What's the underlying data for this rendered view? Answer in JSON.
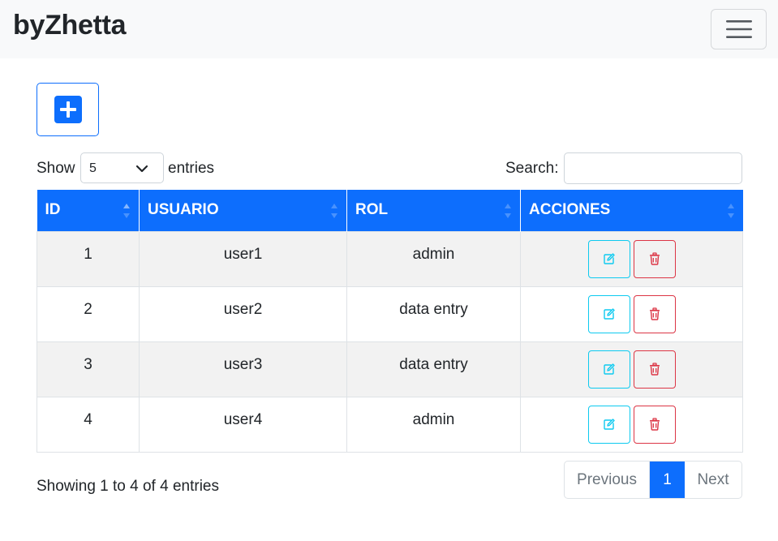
{
  "navbar": {
    "brand": "byZhetta",
    "toggler_icon": "menu-icon"
  },
  "toolbar": {
    "add_icon": "plus-square-icon"
  },
  "length_control": {
    "show_label": "Show",
    "selected_value": "5",
    "entries_label": "entries"
  },
  "search": {
    "label": "Search:",
    "value": "",
    "placeholder": ""
  },
  "table": {
    "columns": [
      "ID",
      "USUARIO",
      "ROL",
      "ACCIONES"
    ],
    "rows": [
      {
        "id": "1",
        "usuario": "user1",
        "rol": "admin"
      },
      {
        "id": "2",
        "usuario": "user2",
        "rol": "data entry"
      },
      {
        "id": "3",
        "usuario": "user3",
        "rol": "data entry"
      },
      {
        "id": "4",
        "usuario": "user4",
        "rol": "admin"
      }
    ],
    "edit_icon": "edit-icon",
    "delete_icon": "trash-icon"
  },
  "footer": {
    "info": "Showing 1 to 4 of 4 entries",
    "pagination": {
      "previous": "Previous",
      "current": "1",
      "next": "Next"
    }
  },
  "colors": {
    "primary": "#0d6efd",
    "info": "#0dcaf0",
    "danger": "#dc3545",
    "navbar_bg": "#f8f9fa",
    "stripe_bg": "#f2f2f2"
  }
}
